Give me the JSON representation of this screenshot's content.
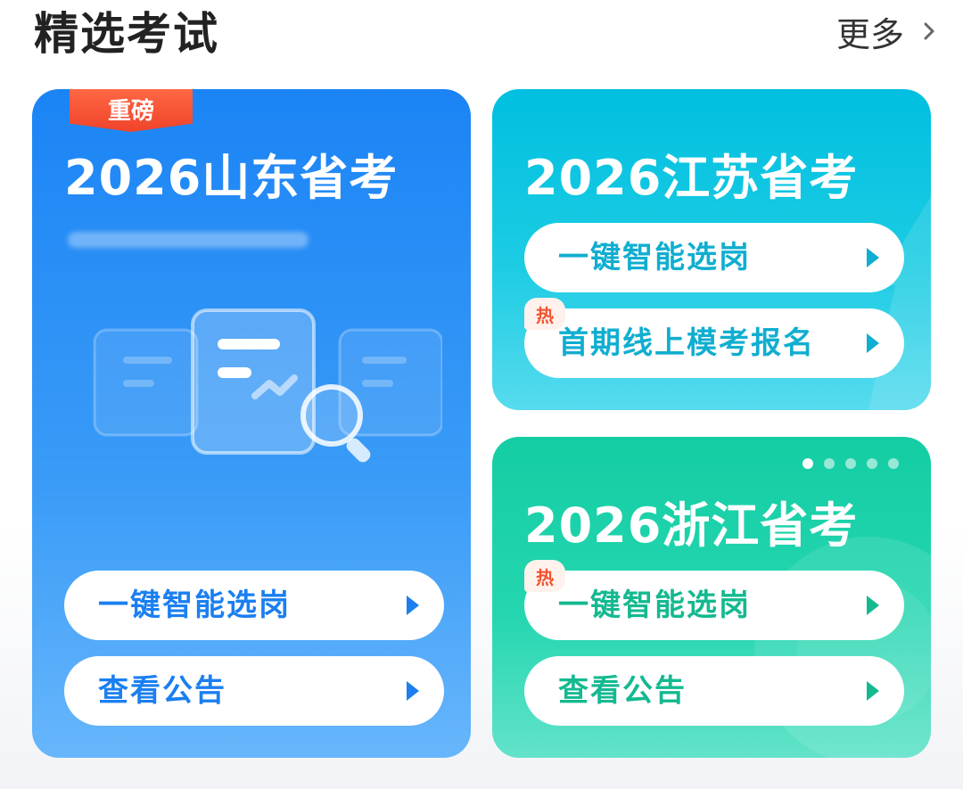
{
  "header": {
    "title": "精选考试",
    "more_label": "更多"
  },
  "cards": [
    {
      "title": "2026山东省考",
      "badge": "重磅",
      "buttons": [
        {
          "label": "一键智能选岗"
        },
        {
          "label": "查看公告"
        }
      ]
    },
    {
      "title": "2026江苏省考",
      "hot_tag": "热",
      "buttons": [
        {
          "label": "一键智能选岗"
        },
        {
          "label": "首期线上模考报名"
        }
      ]
    },
    {
      "title": "2026浙江省考",
      "hot_tag": "热",
      "pager": {
        "count": 5,
        "active": 0
      },
      "buttons": [
        {
          "label": "一键智能选岗"
        },
        {
          "label": "查看公告"
        }
      ]
    }
  ],
  "colors": {
    "shandong": "#1b84f5",
    "jiangsu": "#00bfe0",
    "zhejiang": "#14cda3",
    "badge": "#f0432b"
  }
}
